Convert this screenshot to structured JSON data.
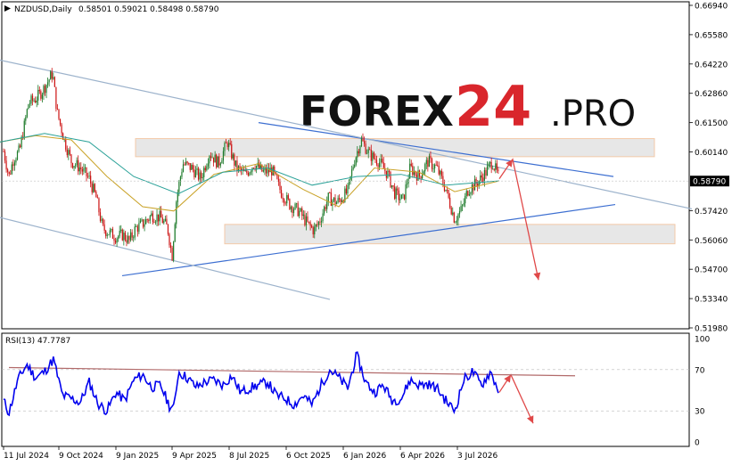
{
  "header": {
    "symbol_line": "NZDUSD,Daily",
    "ohlc_line": "0.58501 0.59021 0.58498 0.58790"
  },
  "watermark": {
    "part1": "FOREX",
    "part2": "24",
    "part3": ".PRO"
  },
  "colors": {
    "bull": "#1d7a2a",
    "bear": "#cc1111",
    "ma_fast": "#c9a227",
    "ma_slow": "#2aa198",
    "trend": "#3d6fd1",
    "channel": "#9db3cc",
    "zone_fill": "#e3e3e3",
    "zone_border": "#f2c199",
    "forecast": "#e04848",
    "rsi": "#0000ee",
    "rsi_trend": "#b26a6a"
  },
  "chart_data": [
    {
      "type": "candlestick",
      "title": "NZDUSD,Daily",
      "price_axis": {
        "labels": [
          "0.66940",
          "0.65580",
          "0.64220",
          "0.62860",
          "0.61500",
          "0.60140",
          "0.58790",
          "0.57420",
          "0.56060",
          "0.54700",
          "0.53340",
          "0.51980"
        ],
        "current_price": "0.58790",
        "ylim": [
          0.5198,
          0.6694
        ]
      },
      "x_tick_labels": [
        "11 Jul 2024",
        "9 Oct 2024",
        "9 Jan 2025",
        "9 Apr 2025",
        "8 Jul 2025",
        "6 Oct 2025",
        "6 Jan 2026",
        "6 Apr 2026",
        "3 Jul 2026"
      ],
      "price_path": [
        [
          0,
          0.608
        ],
        [
          5,
          0.6
        ],
        [
          10,
          0.59
        ],
        [
          15,
          0.598
        ],
        [
          22,
          0.602
        ],
        [
          32,
          0.624
        ],
        [
          40,
          0.626
        ],
        [
          48,
          0.63
        ],
        [
          55,
          0.635
        ],
        [
          59,
          0.638
        ],
        [
          64,
          0.62
        ],
        [
          72,
          0.607
        ],
        [
          80,
          0.597
        ],
        [
          90,
          0.594
        ],
        [
          100,
          0.589
        ],
        [
          108,
          0.58
        ],
        [
          115,
          0.566
        ],
        [
          122,
          0.564
        ],
        [
          130,
          0.562
        ],
        [
          138,
          0.563
        ],
        [
          145,
          0.56
        ],
        [
          152,
          0.566
        ],
        [
          160,
          0.568
        ],
        [
          170,
          0.572
        ],
        [
          180,
          0.571
        ],
        [
          188,
          0.566
        ],
        [
          193,
          0.553
        ],
        [
          198,
          0.58
        ],
        [
          205,
          0.596
        ],
        [
          215,
          0.594
        ],
        [
          225,
          0.589
        ],
        [
          235,
          0.601
        ],
        [
          245,
          0.596
        ],
        [
          255,
          0.606
        ],
        [
          265,
          0.594
        ],
        [
          275,
          0.591
        ],
        [
          285,
          0.596
        ],
        [
          295,
          0.592
        ],
        [
          305,
          0.593
        ],
        [
          315,
          0.583
        ],
        [
          325,
          0.577
        ],
        [
          335,
          0.574
        ],
        [
          345,
          0.568
        ],
        [
          352,
          0.565
        ],
        [
          358,
          0.569
        ],
        [
          368,
          0.58
        ],
        [
          378,
          0.578
        ],
        [
          390,
          0.583
        ],
        [
          397,
          0.597
        ],
        [
          405,
          0.607
        ],
        [
          415,
          0.6
        ],
        [
          425,
          0.597
        ],
        [
          435,
          0.591
        ],
        [
          443,
          0.582
        ],
        [
          452,
          0.579
        ],
        [
          460,
          0.594
        ],
        [
          470,
          0.59
        ],
        [
          480,
          0.597
        ],
        [
          490,
          0.594
        ],
        [
          500,
          0.584
        ],
        [
          510,
          0.57
        ],
        [
          518,
          0.575
        ],
        [
          525,
          0.584
        ],
        [
          535,
          0.587
        ],
        [
          545,
          0.592
        ],
        [
          552,
          0.597
        ],
        [
          560,
          0.589
        ]
      ],
      "moving_averages": [
        {
          "color_key": "ma_fast",
          "points": [
            [
              0,
              0.606
            ],
            [
              40,
              0.609
            ],
            [
              80,
              0.607
            ],
            [
              120,
              0.59
            ],
            [
              160,
              0.576
            ],
            [
              195,
              0.574
            ],
            [
              240,
              0.591
            ],
            [
              290,
              0.596
            ],
            [
              340,
              0.584
            ],
            [
              380,
              0.576
            ],
            [
              420,
              0.594
            ],
            [
              470,
              0.592
            ],
            [
              510,
              0.583
            ],
            [
              560,
              0.588
            ]
          ]
        },
        {
          "color_key": "ma_slow",
          "points": [
            [
              0,
              0.606
            ],
            [
              50,
              0.61
            ],
            [
              100,
              0.606
            ],
            [
              150,
              0.59
            ],
            [
              200,
              0.582
            ],
            [
              250,
              0.592
            ],
            [
              300,
              0.594
            ],
            [
              350,
              0.586
            ],
            [
              400,
              0.59
            ],
            [
              450,
              0.591
            ],
            [
              500,
              0.586
            ],
            [
              560,
              0.588
            ]
          ]
        }
      ],
      "trend_lines": [
        {
          "color_key": "trend",
          "from": [
            290,
            0.615
          ],
          "to": [
            688,
            0.59
          ]
        },
        {
          "color_key": "trend",
          "from": [
            137,
            0.544
          ],
          "to": [
            690,
            0.577
          ]
        },
        {
          "color_key": "channel",
          "from": [
            0,
            0.644
          ],
          "to": [
            776,
            0.575
          ]
        },
        {
          "color_key": "channel",
          "from": [
            0,
            0.571
          ],
          "to": [
            370,
            0.533
          ]
        }
      ],
      "zones": [
        {
          "from_x": 152,
          "to_x": 734,
          "high": 0.6076,
          "low": 0.5992
        },
        {
          "from_x": 252,
          "to_x": 757,
          "high": 0.5678,
          "low": 0.5588
        }
      ],
      "forecast_path": [
        [
          560,
          0.589
        ],
        [
          575,
          0.598
        ],
        [
          604,
          0.542
        ]
      ]
    },
    {
      "type": "line",
      "title": "RSI(13) 47.7787",
      "ylim": [
        0,
        100
      ],
      "axis_labels": [
        "100",
        "70",
        "30",
        "0"
      ],
      "levels": [
        70,
        30
      ],
      "rsi_path": [
        [
          0,
          48
        ],
        [
          10,
          28
        ],
        [
          20,
          60
        ],
        [
          30,
          75
        ],
        [
          40,
          62
        ],
        [
          50,
          68
        ],
        [
          60,
          80
        ],
        [
          70,
          45
        ],
        [
          80,
          42
        ],
        [
          90,
          38
        ],
        [
          100,
          58
        ],
        [
          110,
          37
        ],
        [
          120,
          30
        ],
        [
          130,
          48
        ],
        [
          140,
          40
        ],
        [
          150,
          60
        ],
        [
          160,
          65
        ],
        [
          170,
          53
        ],
        [
          180,
          55
        ],
        [
          190,
          35
        ],
        [
          195,
          32
        ],
        [
          200,
          68
        ],
        [
          210,
          62
        ],
        [
          220,
          53
        ],
        [
          230,
          58
        ],
        [
          240,
          60
        ],
        [
          250,
          55
        ],
        [
          260,
          64
        ],
        [
          270,
          48
        ],
        [
          280,
          52
        ],
        [
          290,
          55
        ],
        [
          300,
          58
        ],
        [
          310,
          45
        ],
        [
          320,
          42
        ],
        [
          330,
          36
        ],
        [
          340,
          45
        ],
        [
          350,
          36
        ],
        [
          360,
          55
        ],
        [
          370,
          70
        ],
        [
          380,
          62
        ],
        [
          390,
          52
        ],
        [
          400,
          84
        ],
        [
          410,
          58
        ],
        [
          420,
          48
        ],
        [
          430,
          55
        ],
        [
          440,
          40
        ],
        [
          450,
          42
        ],
        [
          460,
          60
        ],
        [
          470,
          55
        ],
        [
          480,
          56
        ],
        [
          490,
          52
        ],
        [
          500,
          40
        ],
        [
          510,
          30
        ],
        [
          520,
          60
        ],
        [
          530,
          68
        ],
        [
          540,
          55
        ],
        [
          550,
          68
        ],
        [
          560,
          48
        ]
      ],
      "trend_line": {
        "from": [
          10,
          72
        ],
        "to": [
          645,
          64
        ]
      },
      "forecast_path": [
        [
          560,
          48
        ],
        [
          573,
          65
        ],
        [
          598,
          18
        ]
      ]
    }
  ]
}
